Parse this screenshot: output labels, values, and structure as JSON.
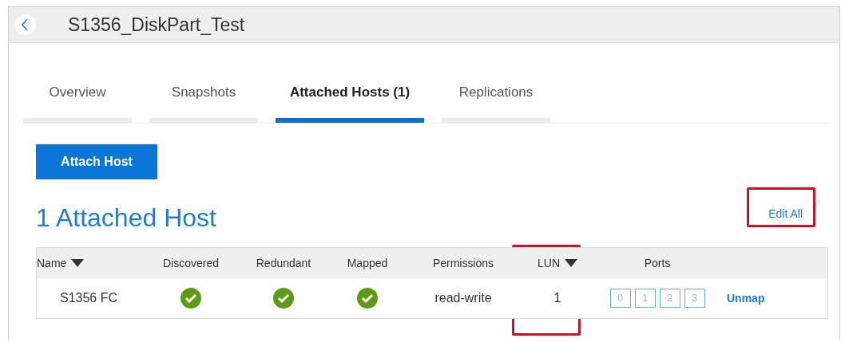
{
  "header": {
    "title": "S1356_DiskPart_Test"
  },
  "tabs": [
    {
      "label": "Overview",
      "selected": false
    },
    {
      "label": "Snapshots",
      "selected": false
    },
    {
      "label": "Attached Hosts (1)",
      "selected": true
    },
    {
      "label": "Replications",
      "selected": false
    }
  ],
  "attach_button": "Attach Host",
  "section_title": "1 Attached Host",
  "edit_all": "Edit All",
  "table": {
    "columns": [
      {
        "label": "Name",
        "sortable": true
      },
      {
        "label": "Discovered",
        "sortable": false
      },
      {
        "label": "Redundant",
        "sortable": false
      },
      {
        "label": "Mapped",
        "sortable": false
      },
      {
        "label": "Permissions",
        "sortable": false
      },
      {
        "label": "LUN",
        "sortable": true
      },
      {
        "label": "Ports",
        "sortable": false
      }
    ],
    "rows": [
      {
        "name": "S1356 FC",
        "discovered": true,
        "redundant": true,
        "mapped": true,
        "permissions": "read-write",
        "lun": "1",
        "ports": [
          "0",
          "1",
          "2",
          "3"
        ],
        "action": "Unmap"
      }
    ]
  }
}
